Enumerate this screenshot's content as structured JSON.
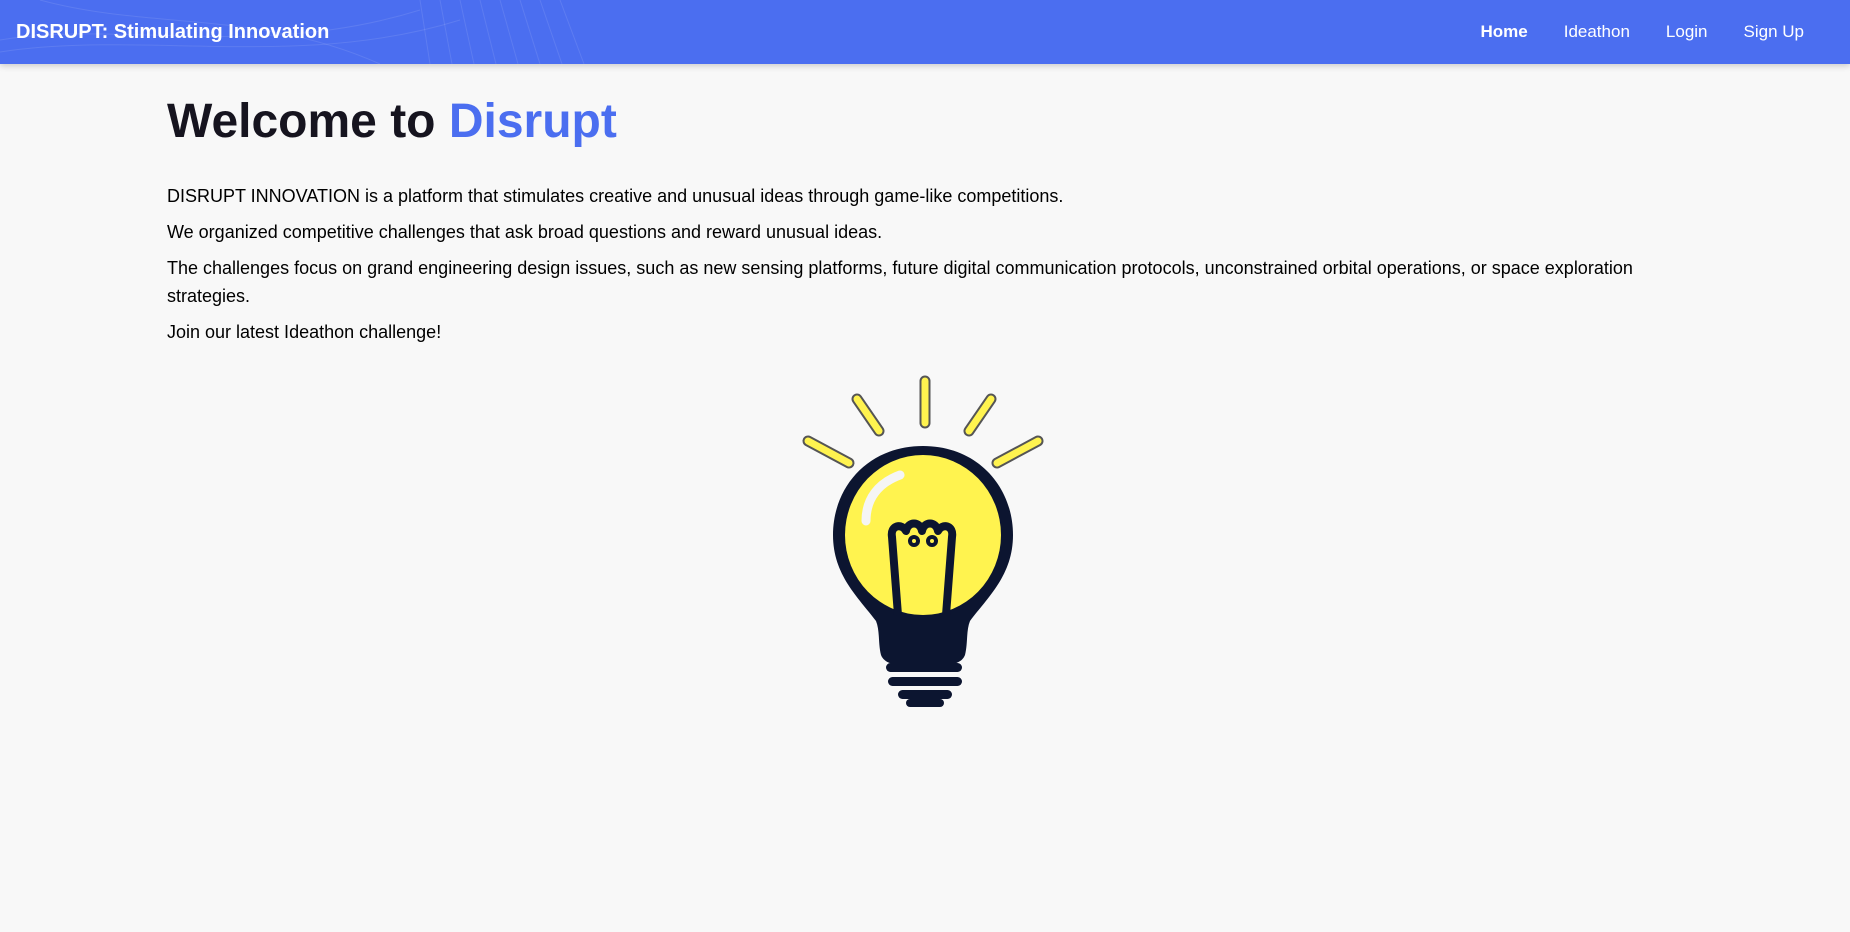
{
  "navbar": {
    "brand": "DISRUPT: Stimulating Innovation",
    "links": [
      {
        "label": "Home",
        "active": true
      },
      {
        "label": "Ideathon",
        "active": false
      },
      {
        "label": "Login",
        "active": false
      },
      {
        "label": "Sign Up",
        "active": false
      }
    ],
    "background_color": "#4b6ef0"
  },
  "main": {
    "heading_prefix": "Welcome to ",
    "heading_accent": "Disrupt",
    "accent_color": "#4b6ef0",
    "paragraphs": [
      "DISRUPT INNOVATION is a platform that stimulates creative and unusual ideas through game-like competitions.",
      "We organized competitive challenges that ask broad questions and reward unusual ideas.",
      "The challenges focus on grand engineering design issues, such as new sensing platforms, future digital communication protocols, unconstrained orbital operations, or space exploration strategies.",
      "Join our latest Ideathon challenge!"
    ],
    "illustration": {
      "icon": "lightbulb-icon",
      "bulb_color": "#fff34f",
      "outline_color": "#0c1530"
    }
  }
}
